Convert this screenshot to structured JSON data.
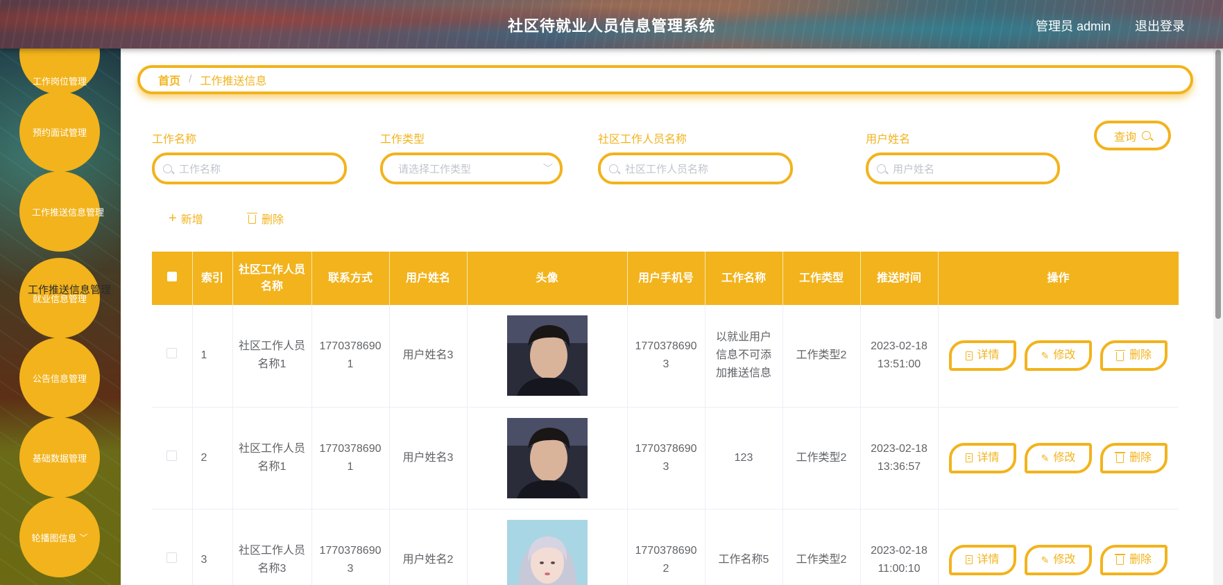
{
  "header": {
    "title": "社区待就业人员信息管理系统",
    "admin_label": "管理员 admin",
    "logout_label": "退出登录"
  },
  "sidebar": {
    "items": [
      {
        "label": "工作岗位管理"
      },
      {
        "label": "预约面试管理"
      },
      {
        "label": "工作推送信息管理"
      },
      {
        "label": "就业信息管理"
      },
      {
        "label": "公告信息管理"
      },
      {
        "label": "基础数据管理"
      },
      {
        "label": "轮播图信息"
      }
    ],
    "submenu_overflow": "工作推送信息管理"
  },
  "breadcrumb": {
    "home": "首页",
    "separator": "/",
    "current": "工作推送信息"
  },
  "search": {
    "job_name": {
      "label": "工作名称",
      "placeholder": "工作名称"
    },
    "job_type": {
      "label": "工作类型",
      "placeholder": "请选择工作类型"
    },
    "worker_name": {
      "label": "社区工作人员名称",
      "placeholder": "社区工作人员名称"
    },
    "user_name": {
      "label": "用户姓名",
      "placeholder": "用户姓名"
    },
    "query_label": "查询"
  },
  "actions": {
    "add_label": "新增",
    "delete_label": "删除"
  },
  "table": {
    "columns": {
      "index": "索引",
      "worker_name": "社区工作人员名称",
      "contact": "联系方式",
      "user_name": "用户姓名",
      "avatar": "头像",
      "user_phone": "用户手机号",
      "job_name": "工作名称",
      "job_type": "工作类型",
      "push_time": "推送时间",
      "operation": "操作"
    },
    "op_labels": {
      "detail": "详情",
      "edit": "修改",
      "delete": "删除"
    },
    "rows": [
      {
        "index": "1",
        "worker_name": "社区工作人员名称1",
        "contact": "17703786901",
        "user_name": "用户姓名3",
        "user_phone": "17703786903",
        "job_name": "以就业用户信息不可添加推送信息",
        "job_type": "工作类型2",
        "push_time": "2023-02-18 13:51:00"
      },
      {
        "index": "2",
        "worker_name": "社区工作人员名称1",
        "contact": "17703786901",
        "user_name": "用户姓名3",
        "user_phone": "17703786903",
        "job_name": "123",
        "job_type": "工作类型2",
        "push_time": "2023-02-18 13:36:57"
      },
      {
        "index": "3",
        "worker_name": "社区工作人员名称3",
        "contact": "17703786903",
        "user_name": "用户姓名2",
        "user_phone": "17703786902",
        "job_name": "工作名称5",
        "job_type": "工作类型2",
        "push_time": "2023-02-18 11:00:10"
      }
    ]
  },
  "colors": {
    "accent": "#f2b31c",
    "text": "#606266",
    "placeholder": "#c0c4cc"
  }
}
